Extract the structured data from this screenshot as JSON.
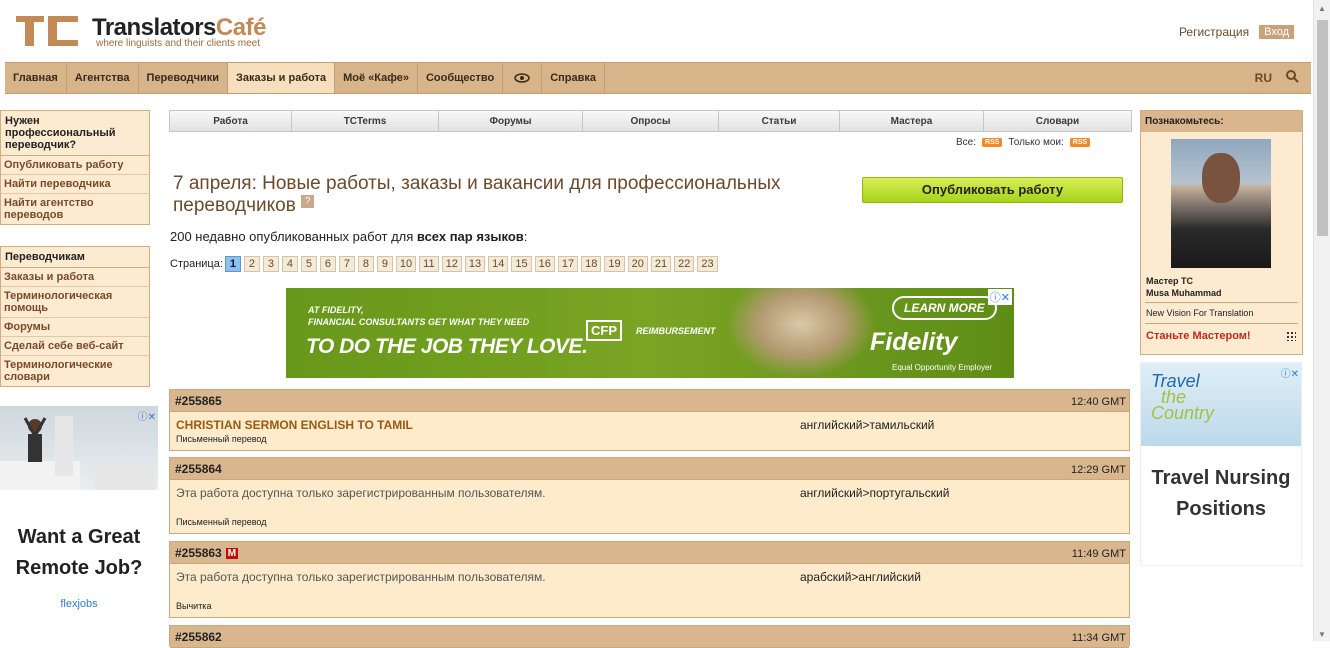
{
  "header": {
    "logo_title_a": "Translators",
    "logo_title_b": "Café",
    "logo_tagline": "where linguists and their clients meet",
    "register": "Регистрация",
    "login": "Вход"
  },
  "nav": {
    "items": [
      "Главная",
      "Агентства",
      "Переводчики",
      "Заказы и работа",
      "Моё «Кафе»",
      "Сообщество",
      "Справка"
    ],
    "lang": "RU"
  },
  "left": {
    "box1_title": "Нужен профессиональный переводчик?",
    "box1_items": [
      "Опубликовать работу",
      "Найти переводчика",
      "Найти агентство переводов"
    ],
    "box2_title": "Переводчикам",
    "box2_items": [
      "Заказы и работа",
      "Терминологическая помощь",
      "Форумы",
      "Сделай себе веб-сайт",
      "Терминологические словари"
    ],
    "ad_text": "Want a Great Remote Job?",
    "ad_brand": "flexjobs"
  },
  "subnav": [
    "Работа",
    "TCTerms",
    "Форумы",
    "Опросы",
    "Статьи",
    "Мастера",
    "Словари"
  ],
  "rss": {
    "all_label": "Все:",
    "mine_label": "Только мои:",
    "badge": "RSS"
  },
  "main": {
    "title": "7 апреля: Новые работы, заказы и вакансии для профессиональных переводчиков",
    "help": "?",
    "publish_button": "Опубликовать работу",
    "count_prefix": "200 недавно опубликованных работ для ",
    "count_bold": "всех пар языков",
    "count_suffix": ":",
    "pager_label": "Страница:",
    "pages": [
      "1",
      "2",
      "3",
      "4",
      "5",
      "6",
      "7",
      "8",
      "9",
      "10",
      "11",
      "12",
      "13",
      "14",
      "15",
      "16",
      "17",
      "18",
      "19",
      "20",
      "21",
      "22",
      "23"
    ],
    "current_page": "1"
  },
  "banner": {
    "line1": "AT FIDELITY,",
    "line2": "FINANCIAL CONSULTANTS GET WHAT THEY NEED",
    "line3": "TO DO THE JOB THEY LOVE.",
    "cfp": "CFP",
    "reimb": "REIMBURSEMENT",
    "learn": "LEARN MORE",
    "brand": "Fidelity",
    "eoe": "Equal Opportunity Employer"
  },
  "jobs": [
    {
      "id": "#255865",
      "time": "12:40 GMT",
      "title": "CHRISTIAN SERMON ENGLISH TO TAMIL",
      "pair": "английский>тамильский",
      "type": "Письменный перевод",
      "badge": ""
    },
    {
      "id": "#255864",
      "time": "12:29 GMT",
      "title": "Эта работа доступна только зарегистрированным пользователям.",
      "pair": "английский>португальский",
      "type": "Письменный перевод",
      "badge": ""
    },
    {
      "id": "#255863",
      "time": "11:49 GMT",
      "title": "Эта работа доступна только зарегистрированным пользователям.",
      "pair": "арабский>английский",
      "type": "Вычитка",
      "badge": "M"
    },
    {
      "id": "#255862",
      "time": "11:34 GMT"
    }
  ],
  "right": {
    "box_title": "Познакомьтесь:",
    "role": "Мастер TC",
    "name": "Musa Muhammad",
    "company": "New Vision For Translation",
    "cta": "Станьте Мастером!",
    "ad_text": "Travel Nursing Positions",
    "ad_img_a": "Travel",
    "ad_img_b": "the",
    "ad_img_c": "Country"
  },
  "colors": {
    "nav_bg": "#d8b48a",
    "accent": "#c18a56",
    "job_header": "#d9b68e",
    "job_body": "#fdebcb"
  }
}
